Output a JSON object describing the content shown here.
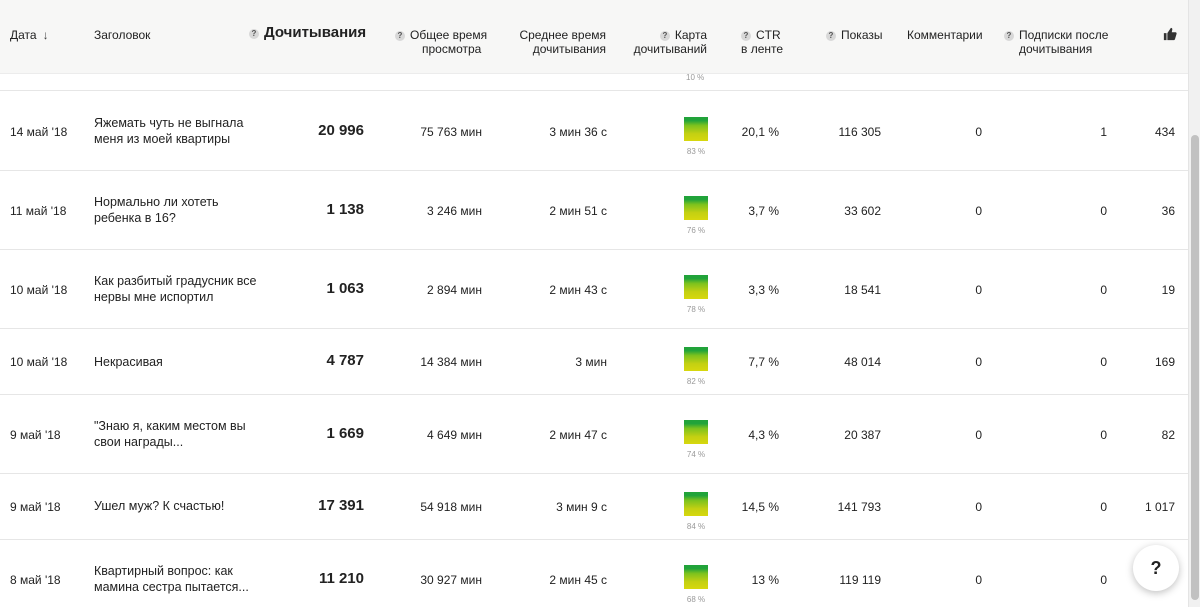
{
  "header": {
    "date": "Дата",
    "title": "Заголовок",
    "reads": "Дочитывания",
    "total_time_1": "Общее время",
    "total_time_2": "просмотра",
    "avg_time_1": "Среднее время",
    "avg_time_2": "дочитывания",
    "map_1": "Карта",
    "map_2": "дочитываний",
    "ctr_1": "CTR",
    "ctr_2": "в ленте",
    "shows": "Показы",
    "comments": "Комментарии",
    "subs_1": "Подписки после",
    "subs_2": "дочитывания",
    "help_mark": "?",
    "sort_arrow": "↓"
  },
  "peek_pct": "10 %",
  "rows": [
    {
      "date": "14 май '18",
      "title": "Яжемать чуть не выгнала меня из моей квартиры",
      "reads": "20 996",
      "total": "75 763 мин",
      "avg": "3 мин 36 с",
      "pct": "83 %",
      "ctr": "20,1 %",
      "shows": "116 305",
      "comments": "0",
      "subs": "1",
      "likes": "434"
    },
    {
      "date": "11 май '18",
      "title": "Нормально ли хотеть ребенка в 16?",
      "reads": "1 138",
      "total": "3 246 мин",
      "avg": "2 мин 51 с",
      "pct": "76 %",
      "ctr": "3,7 %",
      "shows": "33 602",
      "comments": "0",
      "subs": "0",
      "likes": "36"
    },
    {
      "date": "10 май '18",
      "title": "Как разбитый градусник все нервы мне испортил",
      "reads": "1 063",
      "total": "2 894 мин",
      "avg": "2 мин 43 с",
      "pct": "78 %",
      "ctr": "3,3 %",
      "shows": "18 541",
      "comments": "0",
      "subs": "0",
      "likes": "19"
    },
    {
      "date": "10 май '18",
      "title": "Некрасивая",
      "reads": "4 787",
      "total": "14 384 мин",
      "avg": "3 мин",
      "pct": "82 %",
      "ctr": "7,7 %",
      "shows": "48 014",
      "comments": "0",
      "subs": "0",
      "likes": "169"
    },
    {
      "date": "9 май '18",
      "title": "\"Знаю я, каким местом вы свои награды...",
      "reads": "1 669",
      "total": "4 649 мин",
      "avg": "2 мин 47 с",
      "pct": "74 %",
      "ctr": "4,3 %",
      "shows": "20 387",
      "comments": "0",
      "subs": "0",
      "likes": "82"
    },
    {
      "date": "9 май '18",
      "title": "Ушел муж? К счастью!",
      "reads": "17 391",
      "total": "54 918 мин",
      "avg": "3 мин 9 с",
      "pct": "84 %",
      "ctr": "14,5 %",
      "shows": "141 793",
      "comments": "0",
      "subs": "0",
      "likes": "1 017"
    },
    {
      "date": "8 май '18",
      "title": "Квартирный вопрос: как мамина сестра пытается...",
      "reads": "11 210",
      "total": "30 927 мин",
      "avg": "2 мин 45 с",
      "pct": "68 %",
      "ctr": "13 %",
      "shows": "119 119",
      "comments": "0",
      "subs": "0",
      "likes": ""
    }
  ],
  "help_button": "?",
  "icons": {
    "thumb": "thumbs-up-icon",
    "sort": "sort-down-icon",
    "help": "question-icon"
  }
}
